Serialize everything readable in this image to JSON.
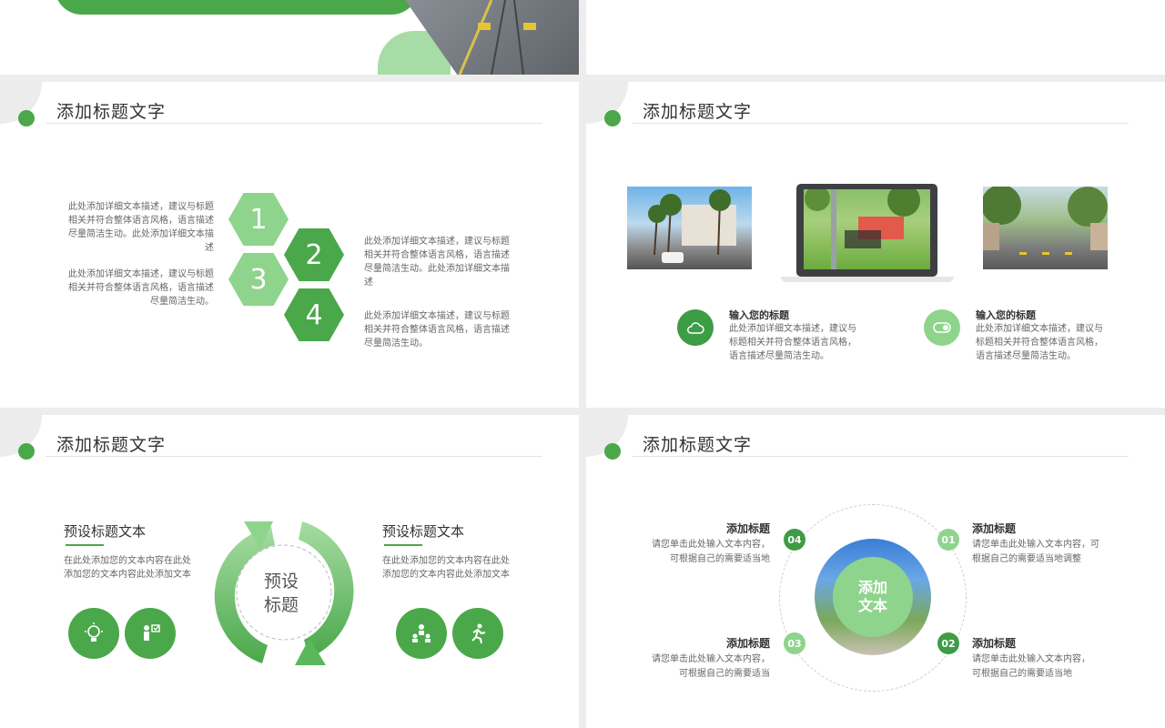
{
  "slide_title": "添加标题文字",
  "slide1": {
    "left_texts": [
      "此处添加详细文本描述，建议与标题相关并符合整体语言风格，语言描述尽量简洁生动。此处添加详细文本描述",
      "此处添加详细文本描述，建议与标题相关并符合整体语言风格，语言描述尽量简洁生动。"
    ],
    "right_texts": [
      "此处添加详细文本描述，建议与标题相关并符合整体语言风格，语言描述尽量简洁生动。此处添加详细文本描述",
      "此处添加详细文本描述，建议与标题相关并符合整体语言风格，语言描述尽量简洁生动。"
    ],
    "hex_numbers": [
      "1",
      "2",
      "3",
      "4"
    ]
  },
  "slide2": {
    "items": [
      {
        "title": "输入您的标题",
        "text": "此处添加详细文本描述，建议与标题相关并符合整体语言风格，语言描述尽量简洁生动。",
        "icon": "cloud-icon"
      },
      {
        "title": "输入您的标题",
        "text": "此处添加详细文本描述，建议与标题相关并符合整体语言风格，语言描述尽量简洁生动。",
        "icon": "toggle-icon"
      }
    ]
  },
  "slide3": {
    "center": "预设标题",
    "center_line1": "预设",
    "center_line2": "标题",
    "left": {
      "title": "预设标题文本",
      "text": "在此处添加您的文本内容在此处添加您的文本内容此处添加文本"
    },
    "right": {
      "title": "预设标题文本",
      "text": "在此处添加您的文本内容在此处添加您的文本内容此处添加文本"
    }
  },
  "slide4": {
    "center_line1": "添加",
    "center_line2": "文本",
    "items": [
      {
        "num": "04",
        "title": "添加标题",
        "text1": "请您单击此处输入文本内容，",
        "text2": "可根据自己的需要适当地"
      },
      {
        "num": "01",
        "title": "添加标题",
        "text1": "请您单击此处输入文本内容，可",
        "text2": "根据自己的需要适当地调整"
      },
      {
        "num": "03",
        "title": "添加标题",
        "text1": "请您单击此处输入文本内容，",
        "text2": "可根据自己的需要适当"
      },
      {
        "num": "02",
        "title": "添加标题",
        "text1": "请您单击此处输入文本内容，",
        "text2": "可根据自己的需要适当地"
      }
    ]
  },
  "colors": {
    "accent": "#4aa84a",
    "accent_light": "#8fd48c"
  }
}
